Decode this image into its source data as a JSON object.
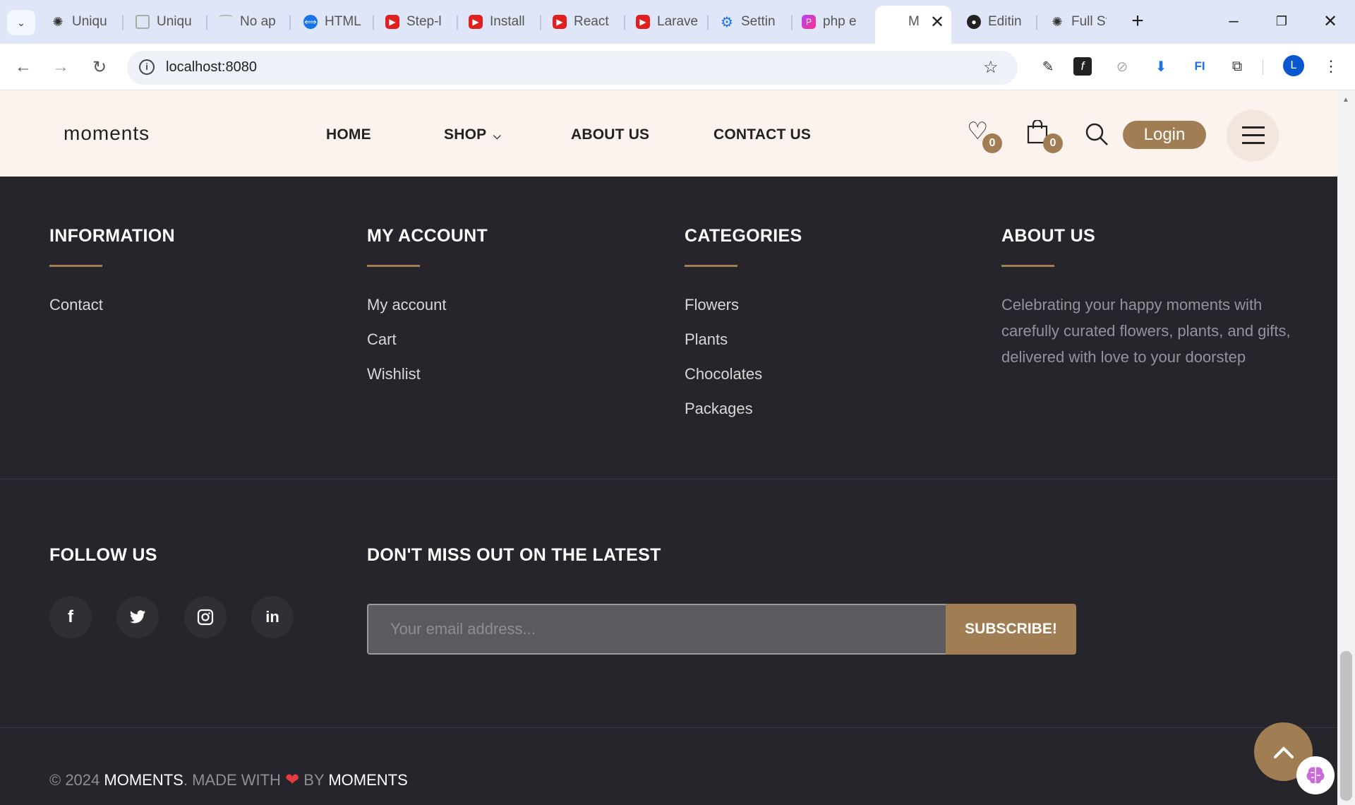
{
  "browser": {
    "tabs": [
      {
        "title": "Uniqu",
        "icon": "chatgpt-icon"
      },
      {
        "title": "Uniqu",
        "icon": "copy-icon"
      },
      {
        "title": "No ap",
        "icon": "generic-page-icon"
      },
      {
        "title": "HTML",
        "icon": "html-icon"
      },
      {
        "title": "Step-l",
        "icon": "youtube-icon"
      },
      {
        "title": "Install",
        "icon": "youtube-icon"
      },
      {
        "title": "React",
        "icon": "youtube-icon"
      },
      {
        "title": "Larave",
        "icon": "youtube-icon"
      },
      {
        "title": "Settin",
        "icon": "gear-icon"
      },
      {
        "title": "php e",
        "icon": "phpstorm-icon"
      },
      {
        "title": "M",
        "icon": "",
        "active": true
      },
      {
        "title": "Editin",
        "icon": "github-icon"
      },
      {
        "title": "Full St",
        "icon": "chatgpt-icon"
      }
    ],
    "url": "localhost:8080",
    "profile_initial": "L",
    "accent": "#0b57d0"
  },
  "site": {
    "logo": "moments",
    "nav": [
      {
        "label": "HOME"
      },
      {
        "label": "SHOP"
      },
      {
        "label": "ABOUT US"
      },
      {
        "label": "CONTACT US"
      }
    ],
    "wishlist_count": "0",
    "cart_count": "0",
    "login_label": "Login",
    "brand_color": "#a07d52"
  },
  "footer": {
    "columns": [
      {
        "heading": "INFORMATION",
        "links": [
          "Contact"
        ]
      },
      {
        "heading": "MY ACCOUNT",
        "links": [
          "My account",
          "Cart",
          "Wishlist"
        ]
      },
      {
        "heading": "CATEGORIES",
        "links": [
          "Flowers",
          "Plants",
          "Chocolates",
          "Packages"
        ]
      },
      {
        "heading": "ABOUT US",
        "text": "Celebrating your happy moments with carefully curated flowers, plants, and gifts, delivered with love to your doorstep"
      }
    ],
    "follow_heading": "FOLLOW US",
    "social": [
      "f",
      "t",
      "ig",
      "in"
    ],
    "newsletter_heading": "DON'T MISS OUT ON THE LATEST",
    "email_placeholder": "Your email address...",
    "subscribe_label": "SUBSCRIBE!",
    "copyright": {
      "prefix": "© 2024 ",
      "brand": "MOMENTS",
      "mid": ". MADE WITH ",
      "heart": "❤",
      "by": " BY ",
      "brand2": "MOMENTS"
    }
  }
}
